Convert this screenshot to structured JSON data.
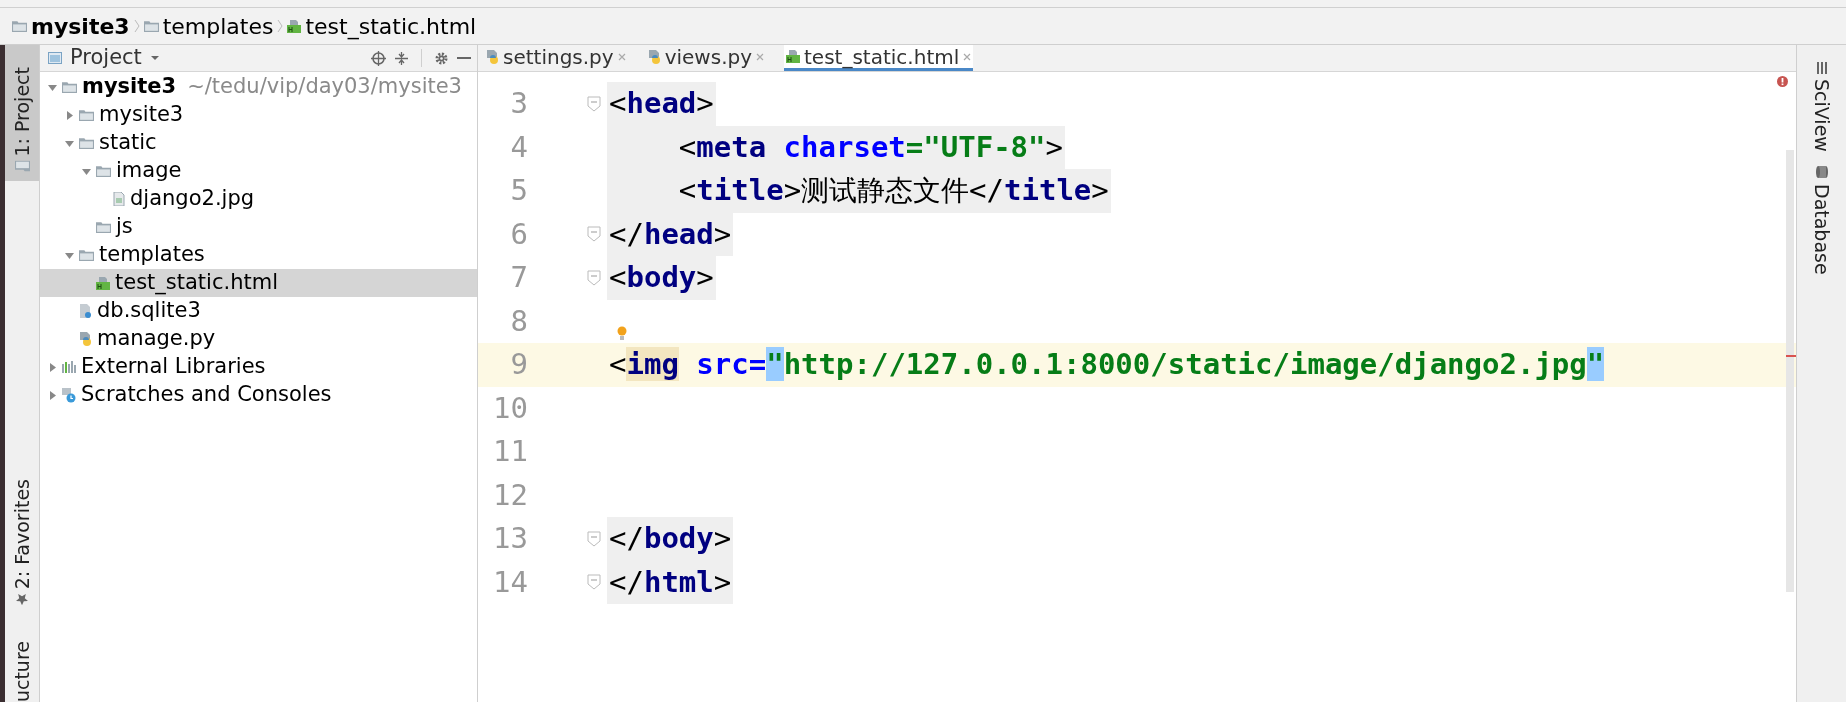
{
  "breadcrumb": [
    {
      "label": "mysite3",
      "kind": "folder",
      "bold": true
    },
    {
      "label": "templates",
      "kind": "folder",
      "bold": false
    },
    {
      "label": "test_static.html",
      "kind": "html",
      "bold": false
    }
  ],
  "left_toolstrip": [
    {
      "label": "1: Project",
      "kind": "folder",
      "selected": true
    },
    {
      "label": "2: Favorites",
      "kind": "star",
      "selected": false
    },
    {
      "label": "ucture",
      "kind": "none",
      "selected": false
    }
  ],
  "project_panel": {
    "title": "Project",
    "tree": [
      {
        "label": "mysite3",
        "path": "~/tedu/vip/day03/mysite3",
        "kind": "folder",
        "expanded": true,
        "selected": false,
        "children": [
          {
            "label": "mysite3",
            "kind": "folder",
            "expanded": false,
            "selected": false
          },
          {
            "label": "static",
            "kind": "folder",
            "expanded": true,
            "selected": false,
            "children": [
              {
                "label": "image",
                "kind": "folder",
                "expanded": true,
                "selected": false,
                "children": [
                  {
                    "label": "django2.jpg",
                    "kind": "image",
                    "selected": false
                  }
                ]
              },
              {
                "label": "js",
                "kind": "folder",
                "selected": false
              }
            ]
          },
          {
            "label": "templates",
            "kind": "folder",
            "expanded": true,
            "selected": false,
            "children": [
              {
                "label": "test_static.html",
                "kind": "html",
                "selected": true
              }
            ]
          },
          {
            "label": "db.sqlite3",
            "kind": "unknown",
            "selected": false
          },
          {
            "label": "manage.py",
            "kind": "python",
            "selected": false
          }
        ]
      },
      {
        "label": "External Libraries",
        "kind": "library",
        "expanded": false,
        "selected": false
      },
      {
        "label": "Scratches and Consoles",
        "kind": "scratch",
        "expanded": false,
        "selected": false
      }
    ]
  },
  "editor": {
    "tabs": [
      {
        "label": "settings.py",
        "kind": "python",
        "selected": false
      },
      {
        "label": "views.py",
        "kind": "python",
        "selected": false
      },
      {
        "label": "test_static.html",
        "kind": "html",
        "selected": true
      }
    ],
    "lines": [
      {
        "number": "3",
        "fold": true,
        "current": false,
        "tokens": [
          {
            "t": "<",
            "kind": "punct"
          },
          {
            "t": "head",
            "kind": "tag"
          },
          {
            "t": ">",
            "kind": "punct"
          }
        ]
      },
      {
        "number": "4",
        "fold": false,
        "current": false,
        "tokens": [
          {
            "t": "    <",
            "kind": "punct"
          },
          {
            "t": "meta",
            "kind": "tag"
          },
          {
            "t": " charset",
            "kind": "attr"
          },
          {
            "t": "=",
            "kind": "string"
          },
          {
            "t": "\"UTF-8\"",
            "kind": "string"
          },
          {
            "t": ">",
            "kind": "punct"
          }
        ]
      },
      {
        "number": "5",
        "fold": false,
        "current": false,
        "tokens": [
          {
            "t": "    <",
            "kind": "punct"
          },
          {
            "t": "title",
            "kind": "tag"
          },
          {
            "t": ">",
            "kind": "punct"
          },
          {
            "t": "测试静态文件",
            "kind": "text"
          },
          {
            "t": "</",
            "kind": "punct"
          },
          {
            "t": "title",
            "kind": "tag"
          },
          {
            "t": ">",
            "kind": "punct"
          }
        ]
      },
      {
        "number": "6",
        "fold": true,
        "current": false,
        "tokens": [
          {
            "t": "</",
            "kind": "punct"
          },
          {
            "t": "head",
            "kind": "tag"
          },
          {
            "t": ">",
            "kind": "punct"
          }
        ]
      },
      {
        "number": "7",
        "fold": true,
        "current": false,
        "tokens": [
          {
            "t": "<",
            "kind": "punct"
          },
          {
            "t": "body",
            "kind": "tag"
          },
          {
            "t": ">",
            "kind": "punct"
          }
        ]
      },
      {
        "number": "8",
        "fold": false,
        "current": false,
        "bulb": true
      },
      {
        "number": "9",
        "fold": false,
        "current": true,
        "tokens": [
          {
            "t": "<",
            "kind": "punct"
          },
          {
            "t": "img",
            "kind": "tag",
            "match": true
          },
          {
            "t": " src",
            "kind": "attr"
          },
          {
            "t": "=",
            "kind": "attr"
          },
          {
            "t": "\"",
            "kind": "string",
            "match": true
          },
          {
            "t": "http://127.0.0.1:8000/static/image/django2.jpg",
            "kind": "string"
          },
          {
            "t": "\"",
            "kind": "string",
            "match": true
          }
        ]
      },
      {
        "number": "10",
        "fold": false,
        "current": false
      },
      {
        "number": "11",
        "fold": false,
        "current": false
      },
      {
        "number": "12",
        "fold": false,
        "current": false
      },
      {
        "number": "13",
        "fold": true,
        "current": false,
        "tokens": [
          {
            "t": "</",
            "kind": "punct"
          },
          {
            "t": "body",
            "kind": "tag"
          },
          {
            "t": ">",
            "kind": "punct"
          }
        ]
      },
      {
        "number": "14",
        "fold": true,
        "current": false,
        "tokens": [
          {
            "t": "</",
            "kind": "punct"
          },
          {
            "t": "html",
            "kind": "tag"
          },
          {
            "t": ">",
            "kind": "punct"
          }
        ]
      }
    ]
  },
  "right_toolstrip": [
    {
      "label": "SciView",
      "kind": "grid"
    },
    {
      "label": "Database",
      "kind": "database"
    }
  ]
}
